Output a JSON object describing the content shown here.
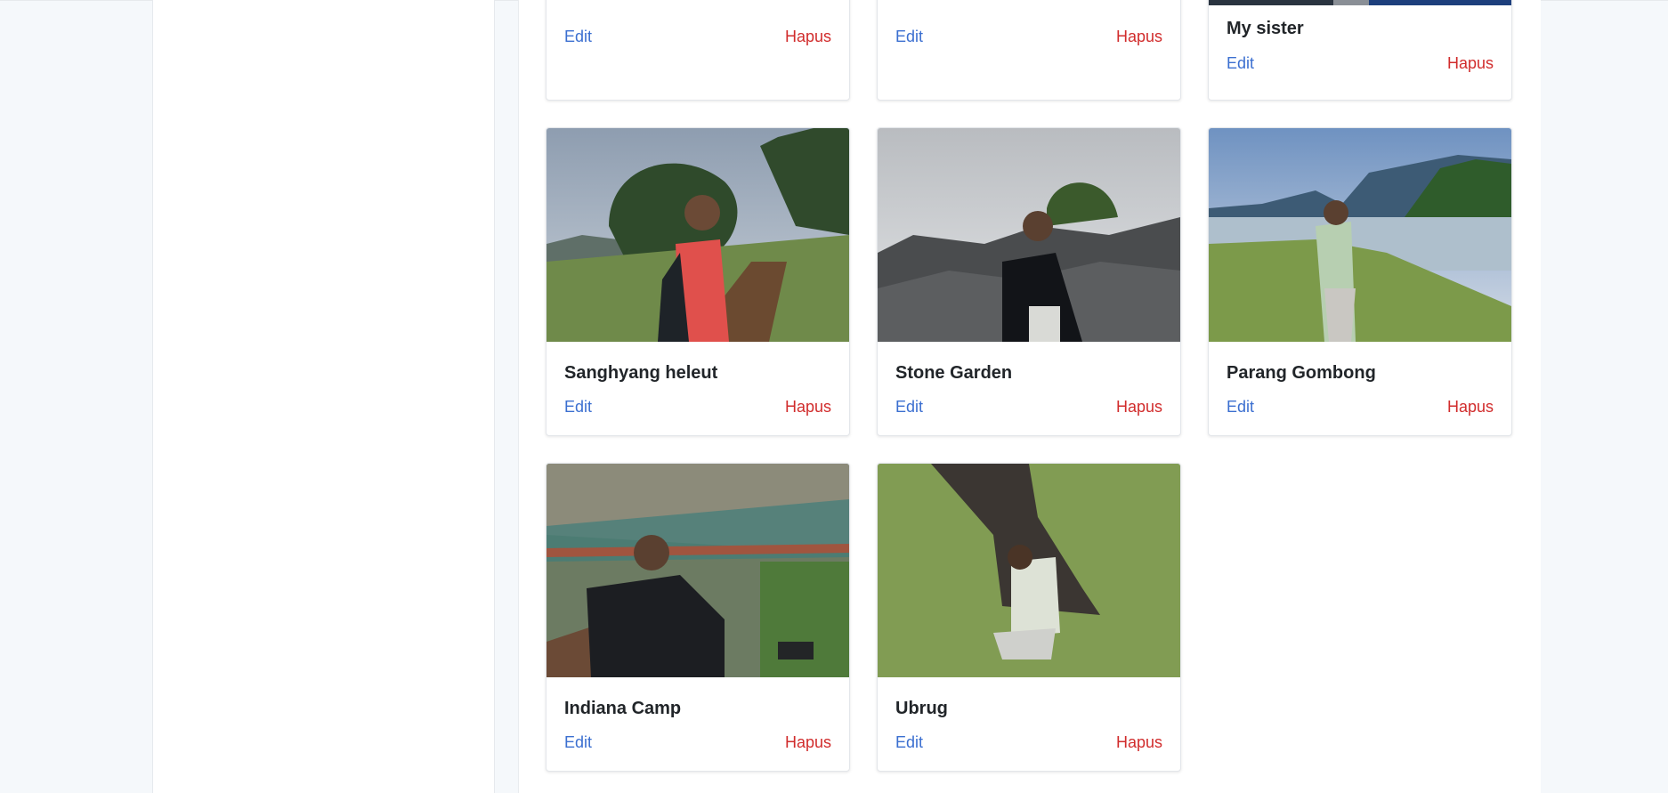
{
  "cards": [
    {
      "title": "",
      "edit_label": "Edit",
      "delete_label": "Hapus"
    },
    {
      "title": "",
      "edit_label": "Edit",
      "delete_label": "Hapus"
    },
    {
      "title": "My sister",
      "edit_label": "Edit",
      "delete_label": "Hapus"
    },
    {
      "title": "Sanghyang heleut",
      "edit_label": "Edit",
      "delete_label": "Hapus"
    },
    {
      "title": "Stone Garden",
      "edit_label": "Edit",
      "delete_label": "Hapus"
    },
    {
      "title": "Parang Gombong",
      "edit_label": "Edit",
      "delete_label": "Hapus"
    },
    {
      "title": "Indiana Camp",
      "edit_label": "Edit",
      "delete_label": "Hapus"
    },
    {
      "title": "Ubrug",
      "edit_label": "Edit",
      "delete_label": "Hapus"
    }
  ],
  "colors": {
    "edit_link": "#3b6fd0",
    "delete_link": "#d12c2c",
    "page_background": "#f5f8fb"
  }
}
